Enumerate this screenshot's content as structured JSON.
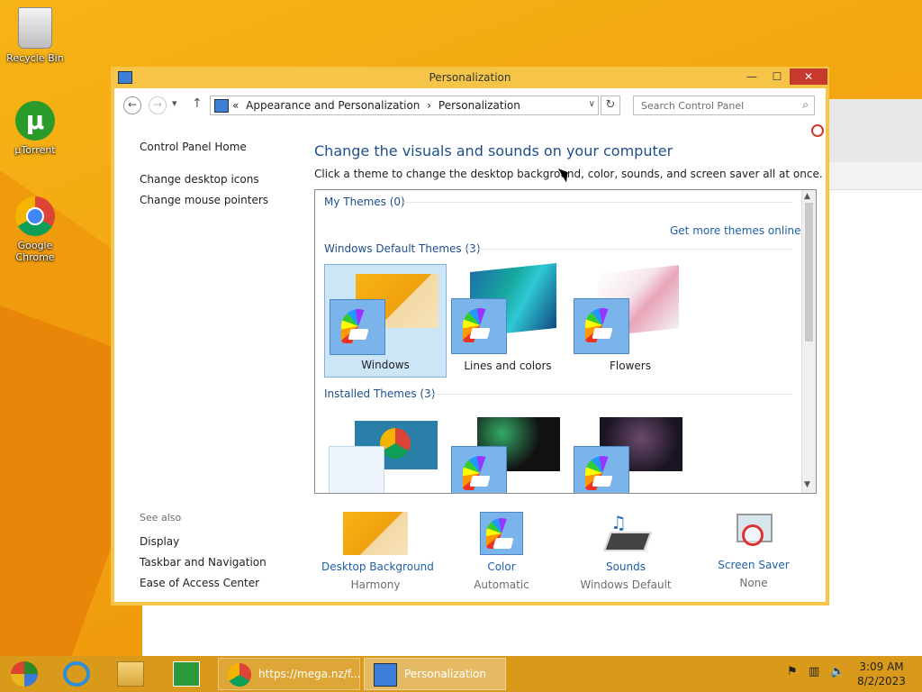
{
  "desktop": {
    "icons": [
      {
        "label": "Recycle Bin",
        "icon": "recycle-bin-icon"
      },
      {
        "label": "µTorrent",
        "icon": "utorrent-icon"
      },
      {
        "label": "Google Chrome",
        "icon": "chrome-icon"
      }
    ]
  },
  "window": {
    "title": "Personalization",
    "buttons": {
      "minimize": "—",
      "maximize": "☐",
      "close": "✕"
    }
  },
  "navbar": {
    "back": "←",
    "forward": "→",
    "recent": "▾",
    "up": "↑",
    "breadcrumb_prefix": "«",
    "breadcrumb": [
      "Appearance and Personalization",
      "›",
      "Personalization"
    ],
    "dropdown": "∨",
    "refresh": "↻",
    "search_placeholder": "Search Control Panel",
    "search_icon": "⌕"
  },
  "left_pane": {
    "home": "Control Panel Home",
    "links": [
      "Change desktop icons",
      "Change mouse pointers"
    ],
    "see_also_label": "See also",
    "see_also": [
      "Display",
      "Taskbar and Navigation",
      "Ease of Access Center"
    ]
  },
  "main": {
    "heading": "Change the visuals and sounds on your computer",
    "subheading": "Click a theme to change the desktop background, color, sounds, and screen saver all at once.",
    "my_themes": "My Themes (0)",
    "get_more": "Get more themes online",
    "default_themes": "Windows Default Themes (3)",
    "default_theme_names": [
      "Windows",
      "Lines and colors",
      "Flowers"
    ],
    "installed_themes": "Installed Themes (3)"
  },
  "bottom": [
    {
      "link": "Desktop Background",
      "value": "Harmony"
    },
    {
      "link": "Color",
      "value": "Automatic"
    },
    {
      "link": "Sounds",
      "value": "Windows Default"
    },
    {
      "link": "Screen Saver",
      "value": "None"
    }
  ],
  "taskbar": {
    "tasks": [
      {
        "label": "https://mega.nz/f...",
        "icon": "chrome-icon"
      },
      {
        "label": "Personalization",
        "icon": "control-panel-icon"
      }
    ],
    "time": "3:09 AM",
    "date": "8/2/2023"
  },
  "colors": {
    "desktop": "#f2a20f",
    "window_frame": "#f6c548",
    "heading": "#1e4f8c",
    "link": "#1e5fa8",
    "close": "#c7382d",
    "selected_tile": "#cde6f7"
  }
}
